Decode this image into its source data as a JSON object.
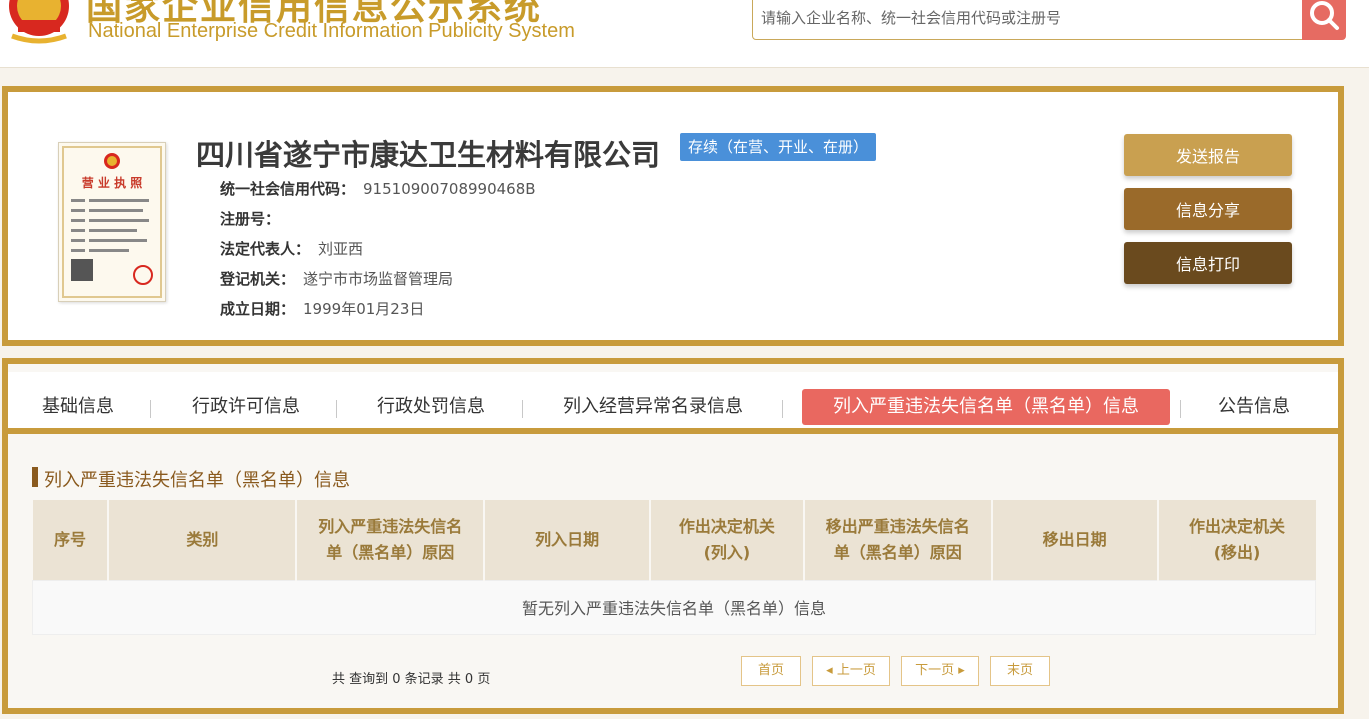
{
  "header": {
    "title_cn": "国家企业信用信息公示系统",
    "title_en": "National Enterprise Credit Information Publicity System",
    "search_placeholder": "请输入企业名称、统一社会信用代码或注册号"
  },
  "company": {
    "name": "四川省遂宁市康达卫生材料有限公司",
    "status": "存续（在营、开业、在册）",
    "license_title": "营 业 执 照",
    "fields": [
      {
        "label": "统一社会信用代码：",
        "value": "91510900708990468B"
      },
      {
        "label": "注册号：",
        "value": ""
      },
      {
        "label": "法定代表人：",
        "value": "刘亚西"
      },
      {
        "label": "登记机关：",
        "value": "遂宁市市场监督管理局"
      },
      {
        "label": "成立日期：",
        "value": "1999年01月23日"
      }
    ],
    "actions": {
      "send_report": "发送报告",
      "share": "信息分享",
      "print": "信息打印"
    }
  },
  "tabs": [
    {
      "label": "基础信息"
    },
    {
      "label": "行政许可信息"
    },
    {
      "label": "行政处罚信息"
    },
    {
      "label": "列入经营异常名录信息"
    },
    {
      "label": "列入严重违法失信名单（黑名单）信息"
    },
    {
      "label": "公告信息"
    }
  ],
  "section": {
    "title": "列入严重违法失信名单（黑名单）信息",
    "columns": [
      {
        "line1": "序号",
        "line2": ""
      },
      {
        "line1": "类别",
        "line2": ""
      },
      {
        "line1": "列入严重违法失信名",
        "line2": "单（黑名单）原因"
      },
      {
        "line1": "列入日期",
        "line2": ""
      },
      {
        "line1": "作出决定机关",
        "line2": "(列入)"
      },
      {
        "line1": "移出严重违法失信名",
        "line2": "单（黑名单）原因"
      },
      {
        "line1": "移出日期",
        "line2": ""
      },
      {
        "line1": "作出决定机关",
        "line2": "(移出)"
      }
    ],
    "empty_text": "暂无列入严重违法失信名单（黑名单）信息"
  },
  "pager": {
    "total": "共 查询到 0 条记录 共 0 页",
    "first": "首页",
    "prev": "上一页",
    "next": "下一页",
    "last": "末页"
  },
  "colors": {
    "gold": "#c89b3c",
    "active_tab": "#e96860",
    "badge": "#4a90d9",
    "btn_send": "#c9a050",
    "btn_share": "#9a6a2a",
    "btn_print": "#6a4a1e"
  },
  "icons": [
    "national-emblem-icon",
    "search-icon",
    "business-license-image"
  ]
}
